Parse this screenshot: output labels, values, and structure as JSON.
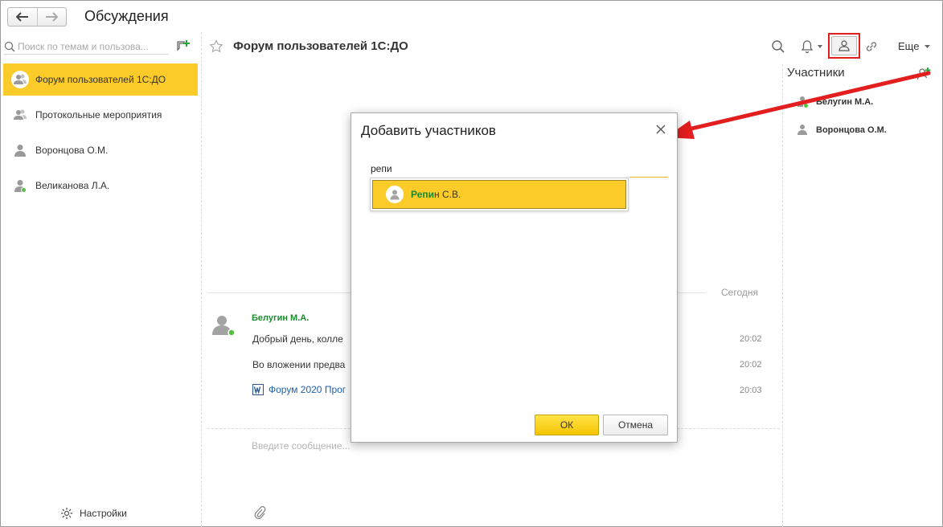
{
  "header": {
    "title": "Обсуждения",
    "back_icon": "arrow-left-icon",
    "forward_icon": "arrow-right-icon"
  },
  "sidebar": {
    "search_placeholder": "Поиск по темам и пользова...",
    "items": [
      {
        "label": "Форум пользователей 1С:ДО",
        "icon": "group-icon",
        "active": true
      },
      {
        "label": "Протокольные мероприятия",
        "icon": "group-icon",
        "active": false
      },
      {
        "label": "Воронцова О.М.",
        "icon": "user-icon",
        "active": false
      },
      {
        "label": "Великанова Л.А.",
        "icon": "user-icon",
        "online": true,
        "active": false
      }
    ],
    "settings_label": "Настройки"
  },
  "discussion": {
    "title": "Форум пользователей 1С:ДО",
    "more_label": "Еще",
    "day_label": "Сегодня",
    "author": "Белугин М.А.",
    "messages": [
      {
        "text": "Добрый день, колле",
        "time": "20:02"
      },
      {
        "text": "Во вложении предва",
        "time": "20:02"
      },
      {
        "text": "Форум 2020 Прог",
        "time": "20:03",
        "attachment": true
      }
    ],
    "input_placeholder": "Введите сообщение..."
  },
  "members": {
    "title": "Участники",
    "list": [
      {
        "name": "Белугин М.А.",
        "online": true
      },
      {
        "name": "Воронцова О.М.",
        "online": false
      }
    ]
  },
  "dialog": {
    "title": "Добавить участников",
    "input_value": "репи",
    "suggestion": {
      "match": "Репи",
      "rest": "н С.В."
    },
    "ok_label": "ОК",
    "cancel_label": "Отмена"
  },
  "colors": {
    "accent": "#fbcb2a",
    "highlight": "#e31e1e",
    "online": "#55c040",
    "author": "#1b8a2e",
    "link": "#1e5fa8"
  }
}
